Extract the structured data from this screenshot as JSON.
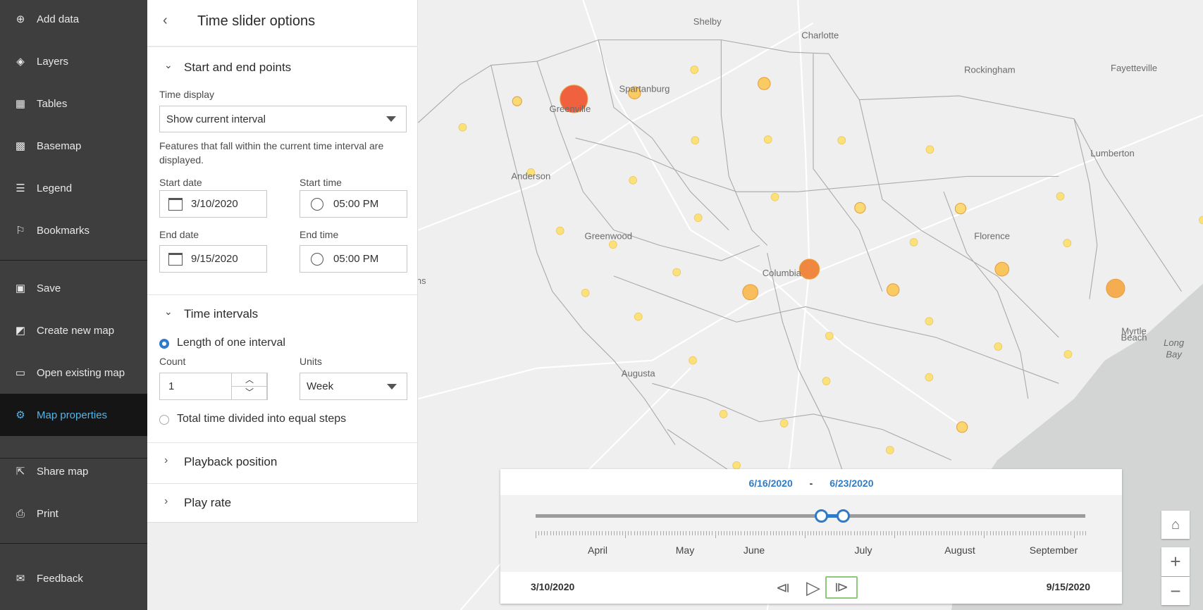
{
  "sidebar": {
    "items": [
      {
        "label": "Add data",
        "icon": "plus-circle-icon"
      },
      {
        "label": "Layers",
        "icon": "layers-icon"
      },
      {
        "label": "Tables",
        "icon": "table-icon"
      },
      {
        "label": "Basemap",
        "icon": "basemap-icon"
      },
      {
        "label": "Legend",
        "icon": "legend-icon"
      },
      {
        "label": "Bookmarks",
        "icon": "bookmark-icon"
      },
      {
        "label": "Save",
        "icon": "save-icon"
      },
      {
        "label": "Create new map",
        "icon": "create-map-icon"
      },
      {
        "label": "Open existing map",
        "icon": "folder-icon"
      },
      {
        "label": "Map properties",
        "icon": "gear-icon",
        "active": true
      },
      {
        "label": "Share map",
        "icon": "share-icon"
      },
      {
        "label": "Print",
        "icon": "print-icon"
      },
      {
        "label": "Feedback",
        "icon": "feedback-icon"
      }
    ],
    "active_color": "#56b4e6"
  },
  "panel": {
    "title": "Time slider options",
    "start_end": {
      "heading": "Start and end points",
      "time_display_label": "Time display",
      "time_display_value": "Show current interval",
      "description": "Features that fall within the current time interval are displayed.",
      "start_date_label": "Start date",
      "start_date": "3/10/2020",
      "start_time_label": "Start time",
      "start_time": "05:00 PM",
      "end_date_label": "End date",
      "end_date": "9/15/2020",
      "end_time_label": "End time",
      "end_time": "05:00 PM"
    },
    "intervals": {
      "heading": "Time intervals",
      "option1": "Length of one interval",
      "option1_selected": true,
      "count_label": "Count",
      "count": "1",
      "units_label": "Units",
      "units": "Week",
      "option2": "Total time divided into equal steps"
    },
    "playback_position": "Playback position",
    "play_rate": "Play rate"
  },
  "map": {
    "cities": [
      "Shelby",
      "Charlotte",
      "Fayetteville",
      "Spartanburg",
      "Rockingham",
      "Greenville",
      "Lumberton",
      "Anderson",
      "Greenwood",
      "Florence",
      "Columbia",
      "ns",
      "Myrtle",
      "Beach",
      "Long",
      "Bay",
      "Augusta"
    ]
  },
  "time_slider": {
    "current_start": "6/16/2020",
    "separator": "-",
    "current_end": "6/23/2020",
    "months": [
      "April",
      "May",
      "June",
      "July",
      "August",
      "September"
    ],
    "full_start": "3/10/2020",
    "full_end": "9/15/2020",
    "accent": "#2f7bc8",
    "current_fraction": [
      0.52,
      0.56
    ]
  }
}
